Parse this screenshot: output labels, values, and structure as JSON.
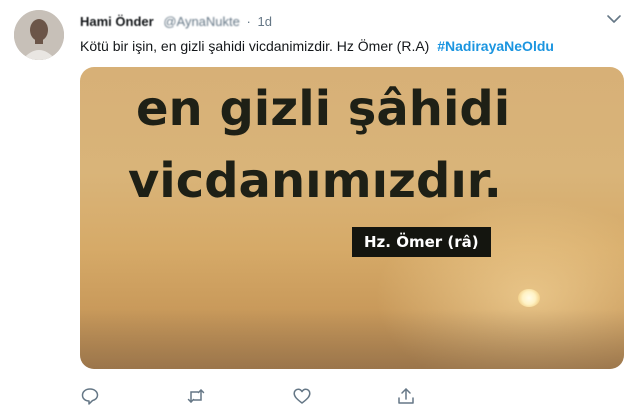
{
  "tweet": {
    "author_name": "Hami Önder",
    "author_handle": "@AynaNukte",
    "separator": "·",
    "time": "1d",
    "text": "Kötü bir işin, en gizli şahidi vicdanimizdir. Hz Ömer (R.A)",
    "hashtag": "#NadirayaNeOldu"
  },
  "media": {
    "line1": "en gizli şâhidi",
    "line2": "vicdanımızdır.",
    "attribution": "Hz. Ömer (râ)"
  },
  "icons": {
    "caret": "chevron-down-icon",
    "reply": "reply-icon",
    "retweet": "retweet-icon",
    "like": "like-icon",
    "share": "share-icon"
  },
  "colors": {
    "link": "#1b95e0",
    "text": "#14171a",
    "muted": "#657786"
  }
}
